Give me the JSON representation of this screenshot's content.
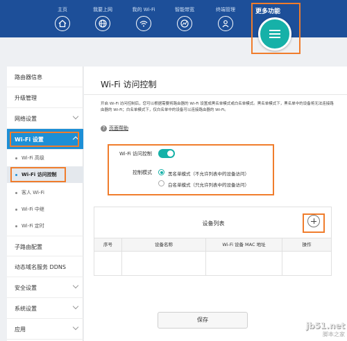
{
  "nav": {
    "items": [
      {
        "label": "主页",
        "icon": "home-icon"
      },
      {
        "label": "我要上网",
        "icon": "globe-icon"
      },
      {
        "label": "我的 Wi-Fi",
        "icon": "wifi-icon"
      },
      {
        "label": "智能带宽",
        "icon": "bandwidth-globe-icon"
      },
      {
        "label": "终端管理",
        "icon": "user-icon"
      }
    ],
    "more_label": "更多功能",
    "more_icon": "menu-icon"
  },
  "sidebar": {
    "items": [
      {
        "label": "路由器信息"
      },
      {
        "label": "升级管理"
      },
      {
        "label": "网络设置"
      },
      {
        "label": "Wi-Fi 设置",
        "active": true
      },
      {
        "label": "子路由配置"
      },
      {
        "label": "动态域名服务 DDNS"
      },
      {
        "label": "安全设置"
      },
      {
        "label": "系统设置"
      },
      {
        "label": "应用"
      }
    ],
    "subitems": [
      {
        "label": "Wi-Fi 高级"
      },
      {
        "label": "Wi-Fi 访问控制",
        "active": true
      },
      {
        "label": "客人 Wi-Fi"
      },
      {
        "label": "Wi-Fi 中继"
      },
      {
        "label": "Wi-Fi 定时"
      }
    ]
  },
  "main": {
    "title": "Wi-Fi 访问控制",
    "description": "开启 Wi-Fi 访问控制后，您可以根据需要将路由器的 Wi-Fi 设置成黑名单模式或白名单模式。黑名单模式下，黑名单中的设备将无法连接路由器的 Wi-Fi；白名单模式下，仅白名单中的设备可以连接路由器的 Wi-Fi。",
    "help_link": "页面帮助",
    "toggle_label": "Wi-Fi 访问控制",
    "toggle_on": true,
    "mode_label": "控制模式",
    "modes": [
      {
        "label": "黑名单模式（不允许列表中的设备访问）",
        "selected": true
      },
      {
        "label": "白名单模式（只允许列表中的设备访问）",
        "selected": false
      }
    ],
    "device_list": {
      "title": "设备列表",
      "columns": [
        "序号",
        "设备名称",
        "Wi-Fi 设备 MAC 地址",
        "操作"
      ]
    },
    "save_label": "保存"
  },
  "watermark": {
    "line1": "jb51.net",
    "line2": "脚本之家"
  },
  "colors": {
    "topbar": "#1d4f99",
    "accent_teal": "#16b1a8",
    "active_blue": "#1d8fd6",
    "highlight_orange": "#f07c2b"
  }
}
